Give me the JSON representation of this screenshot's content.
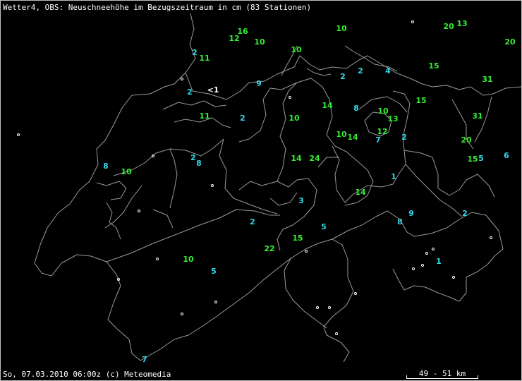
{
  "title": "Wetter4, OBS: Neuschneehöhe im Bezugszeitraum in cm (83 Stationen)",
  "footer": "So, 07.03.2010 06:00z (c) Meteomedia",
  "scale_label": "49 - 51 km",
  "colors": {
    "cyan": "#33d6e8",
    "green": "#33ee33",
    "white": "#ffffff",
    "border": "#9a9a9a"
  },
  "stations": [
    {
      "v": "16",
      "c": "green"
    },
    {
      "v": "12",
      "c": "green"
    },
    {
      "v": "10",
      "c": "green"
    },
    {
      "v": "10",
      "c": "green"
    },
    {
      "v": "20",
      "c": "green"
    },
    {
      "v": "13",
      "c": "green"
    },
    {
      "v": "20",
      "c": "green"
    },
    {
      "v": "2",
      "c": "cyan"
    },
    {
      "v": "11",
      "c": "green"
    },
    {
      "v": "10",
      "c": "green"
    },
    {
      "v": "2",
      "c": "cyan"
    },
    {
      "v": "2",
      "c": "cyan"
    },
    {
      "v": "4",
      "c": "cyan"
    },
    {
      "v": "15",
      "c": "green"
    },
    {
      "v": "31",
      "c": "green"
    },
    {
      "v": "2",
      "c": "cyan"
    },
    {
      "v": "<1",
      "c": "white"
    },
    {
      "v": "9",
      "c": "cyan"
    },
    {
      "v": "15",
      "c": "green"
    },
    {
      "v": "14",
      "c": "green"
    },
    {
      "v": "8",
      "c": "cyan"
    },
    {
      "v": "10",
      "c": "green"
    },
    {
      "v": "13",
      "c": "green"
    },
    {
      "v": "31",
      "c": "green"
    },
    {
      "v": "11",
      "c": "green"
    },
    {
      "v": "2",
      "c": "cyan"
    },
    {
      "v": "10",
      "c": "green"
    },
    {
      "v": "12",
      "c": "green"
    },
    {
      "v": "10",
      "c": "green"
    },
    {
      "v": "14",
      "c": "green"
    },
    {
      "v": "7",
      "c": "cyan"
    },
    {
      "v": "2",
      "c": "cyan"
    },
    {
      "v": "20",
      "c": "green"
    },
    {
      "v": "8",
      "c": "cyan"
    },
    {
      "v": "10",
      "c": "green"
    },
    {
      "v": "2",
      "c": "cyan"
    },
    {
      "v": "8",
      "c": "cyan"
    },
    {
      "v": "14",
      "c": "green"
    },
    {
      "v": "24",
      "c": "green"
    },
    {
      "v": "15",
      "c": "green"
    },
    {
      "v": "5",
      "c": "cyan"
    },
    {
      "v": "6",
      "c": "cyan"
    },
    {
      "v": "1",
      "c": "cyan"
    },
    {
      "v": "14",
      "c": "green"
    },
    {
      "v": "3",
      "c": "cyan"
    },
    {
      "v": "9",
      "c": "cyan"
    },
    {
      "v": "2",
      "c": "cyan"
    },
    {
      "v": "8",
      "c": "cyan"
    },
    {
      "v": "2",
      "c": "cyan"
    },
    {
      "v": "5",
      "c": "cyan"
    },
    {
      "v": "15",
      "c": "green"
    },
    {
      "v": "22",
      "c": "green"
    },
    {
      "v": "10",
      "c": "green"
    },
    {
      "v": "1",
      "c": "cyan"
    },
    {
      "v": "5",
      "c": "cyan"
    },
    {
      "v": "7",
      "c": "cyan"
    }
  ]
}
